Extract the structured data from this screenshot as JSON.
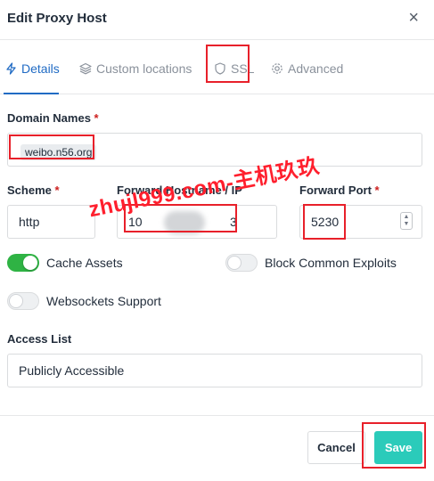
{
  "header": {
    "title": "Edit Proxy Host",
    "close_glyph": "×"
  },
  "tabs": [
    {
      "label": "Details",
      "icon": "bolt-icon",
      "active": true
    },
    {
      "label": "Custom locations",
      "icon": "layers-icon",
      "active": false
    },
    {
      "label": "SSL",
      "icon": "shield-icon",
      "active": false
    },
    {
      "label": "Advanced",
      "icon": "gear-icon",
      "active": false
    }
  ],
  "form": {
    "domain_label": "Domain Names",
    "domain_value": "weibo.n56.org",
    "scheme_label": "Scheme",
    "scheme_value": "http",
    "host_label": "Forward Hostname / IP",
    "host_value_start": "10",
    "host_value_end": "3",
    "port_label": "Forward Port",
    "port_value": "5230",
    "required_mark": "*",
    "cache_assets_label": "Cache Assets",
    "cache_assets_on": true,
    "block_exploits_label": "Block Common Exploits",
    "block_exploits_on": false,
    "websockets_label": "Websockets Support",
    "websockets_on": false,
    "access_list_label": "Access List",
    "access_list_value": "Publicly Accessible"
  },
  "footer": {
    "cancel_label": "Cancel",
    "save_label": "Save"
  },
  "watermark": {
    "text": "zhujl999.com-主机玖玖"
  },
  "colors": {
    "accent": "#206bc4",
    "toggle_on": "#2fb344",
    "save_button": "#2bcbba",
    "required": "#cd201f",
    "highlight_box": "#e8202a"
  }
}
